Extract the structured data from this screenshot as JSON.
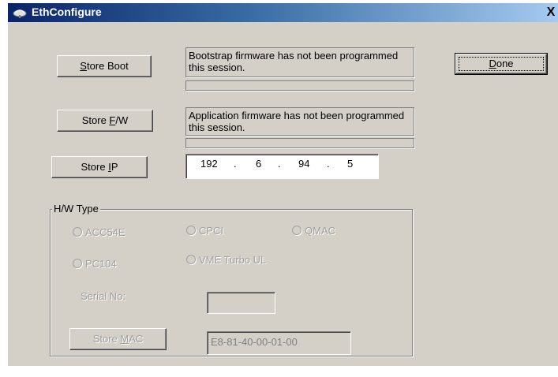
{
  "window": {
    "title": "EthConfigure",
    "close_glyph": "X"
  },
  "boot": {
    "button_pre": "",
    "button_mnemonic": "S",
    "button_post": "tore Boot",
    "message": "Bootstrap firmware has not been programmed this session.",
    "progress": 0
  },
  "firmware": {
    "button_pre": "Store ",
    "button_mnemonic": "F",
    "button_post": "/W",
    "message": "Application firmware has not been programmed this session.",
    "progress": 0
  },
  "ip": {
    "button_pre": "Store ",
    "button_mnemonic": "I",
    "button_post": "P",
    "octets": [
      "192",
      "6",
      "94",
      "5"
    ],
    "separator": "."
  },
  "done": {
    "button_pre": "",
    "button_mnemonic": "D",
    "button_post": "one"
  },
  "hw_type": {
    "label": "H/W Type",
    "options": [
      "ACC54E",
      "CPCI",
      "QMAC",
      "PC104",
      "VME Turbo UL"
    ],
    "serial_label": "Serial No:",
    "serial_value": "",
    "store_mac": {
      "button_pre": "Store ",
      "button_mnemonic": "M",
      "button_post": "AC"
    },
    "mac_value": "E8-81-40-00-01-00"
  },
  "icons": {
    "app": "satellite-dish-icon",
    "close": "close-icon"
  },
  "colors": {
    "titlebar_start": "#0a246a",
    "titlebar_end": "#a6caf0",
    "face": "#d4d0c8"
  }
}
